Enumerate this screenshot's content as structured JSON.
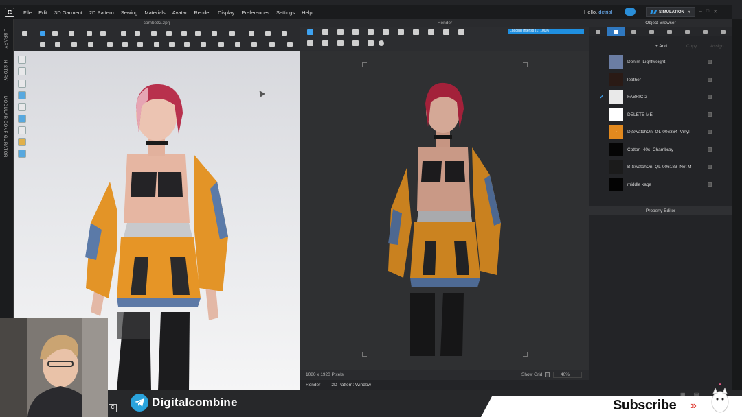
{
  "app": {
    "logo_letter": "C"
  },
  "menu": [
    "File",
    "Edit",
    "3D Garment",
    "2D Pattern",
    "Sewing",
    "Materials",
    "Avatar",
    "Render",
    "Display",
    "Preferences",
    "Settings",
    "Help"
  ],
  "user": {
    "greeting": "Hello,",
    "username": "dctrial"
  },
  "mode": {
    "label": "SIMULATION"
  },
  "left_tabs": [
    "LIBRARY",
    "HISTORY",
    "MODULAR CONFIGURATOR"
  ],
  "viewport3d": {
    "title": "combez2.zprj"
  },
  "render": {
    "title": "Render",
    "progress_label": "Loading Intenss (1) 100%",
    "resolution": "1080 x 1920 Pixels",
    "show_grid_label": "Show Grid",
    "zoom": "40%"
  },
  "bottom_tabs": [
    "Render",
    "2D Pattern: Window"
  ],
  "object_browser": {
    "title": "Object Browser",
    "actions": {
      "add": "Add",
      "copy": "Copy",
      "assign": "Assign"
    },
    "fabrics": [
      {
        "name": "Denim_Lightweight",
        "swatch": "#6b7da3",
        "checked": false
      },
      {
        "name": "leather",
        "swatch": "#2a1a15",
        "checked": false
      },
      {
        "name": "FABRIC 2",
        "swatch": "#e9e9e9",
        "checked": true
      },
      {
        "name": "DELETE ME",
        "swatch": "#ffffff",
        "checked": false
      },
      {
        "name": "D)SwatchOn_QL-006364_Vinyl_",
        "swatch": "#e2891e",
        "checked": false
      },
      {
        "name": "Cotton_40s_Chambray",
        "swatch": "#050505",
        "checked": false
      },
      {
        "name": "B)SwatchOn_QL-006183_Net M",
        "swatch": "#1b1b1b",
        "checked": false
      },
      {
        "name": "middle kage",
        "swatch": "#030303",
        "checked": false
      }
    ]
  },
  "property_editor": {
    "title": "Property Editor"
  },
  "overlay": {
    "channel": "Digitalcombine",
    "subscribe": "Subscribe",
    "chevrons": "»"
  },
  "colors": {
    "accent": "#2f78c0",
    "orange": "#e8921e",
    "denim": "#5d79a6"
  }
}
